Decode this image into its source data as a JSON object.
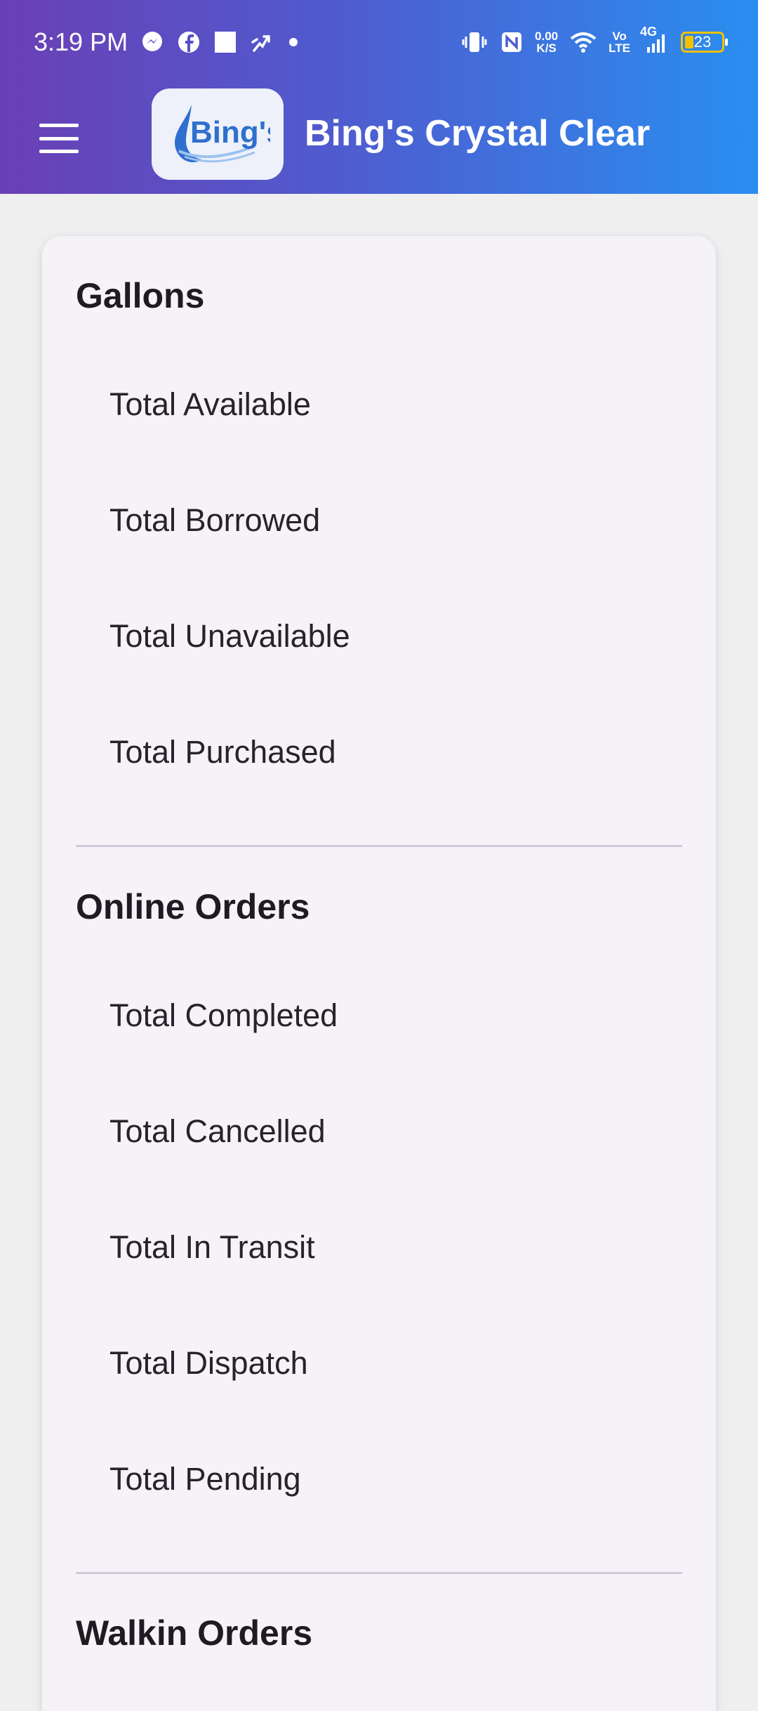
{
  "status_bar": {
    "time": "3:19 PM",
    "network_speed_value": "0.00",
    "network_speed_unit": "K/S",
    "volte_top": "Vo",
    "volte_bottom": "LTE",
    "signal_type": "4G",
    "battery_level": "23",
    "icons": [
      "messenger-icon",
      "facebook-icon",
      "square-icon",
      "activity-icon",
      "dot-icon",
      "vibrate-icon",
      "nfc-icon",
      "wifi-icon",
      "signal-icon",
      "battery-icon"
    ]
  },
  "app_bar": {
    "title": "Bing's Crystal Clear",
    "logo_text": "Bing's",
    "brand_color": "#2f6fce"
  },
  "sections": {
    "gallons": {
      "title": "Gallons",
      "items": [
        "Total Available",
        "Total Borrowed",
        "Total Unavailable",
        "Total Purchased"
      ]
    },
    "online_orders": {
      "title": "Online Orders",
      "items": [
        "Total Completed",
        "Total Cancelled",
        "Total In Transit",
        "Total Dispatch",
        "Total Pending"
      ]
    },
    "walkin_orders": {
      "title": "Walkin Orders"
    }
  }
}
